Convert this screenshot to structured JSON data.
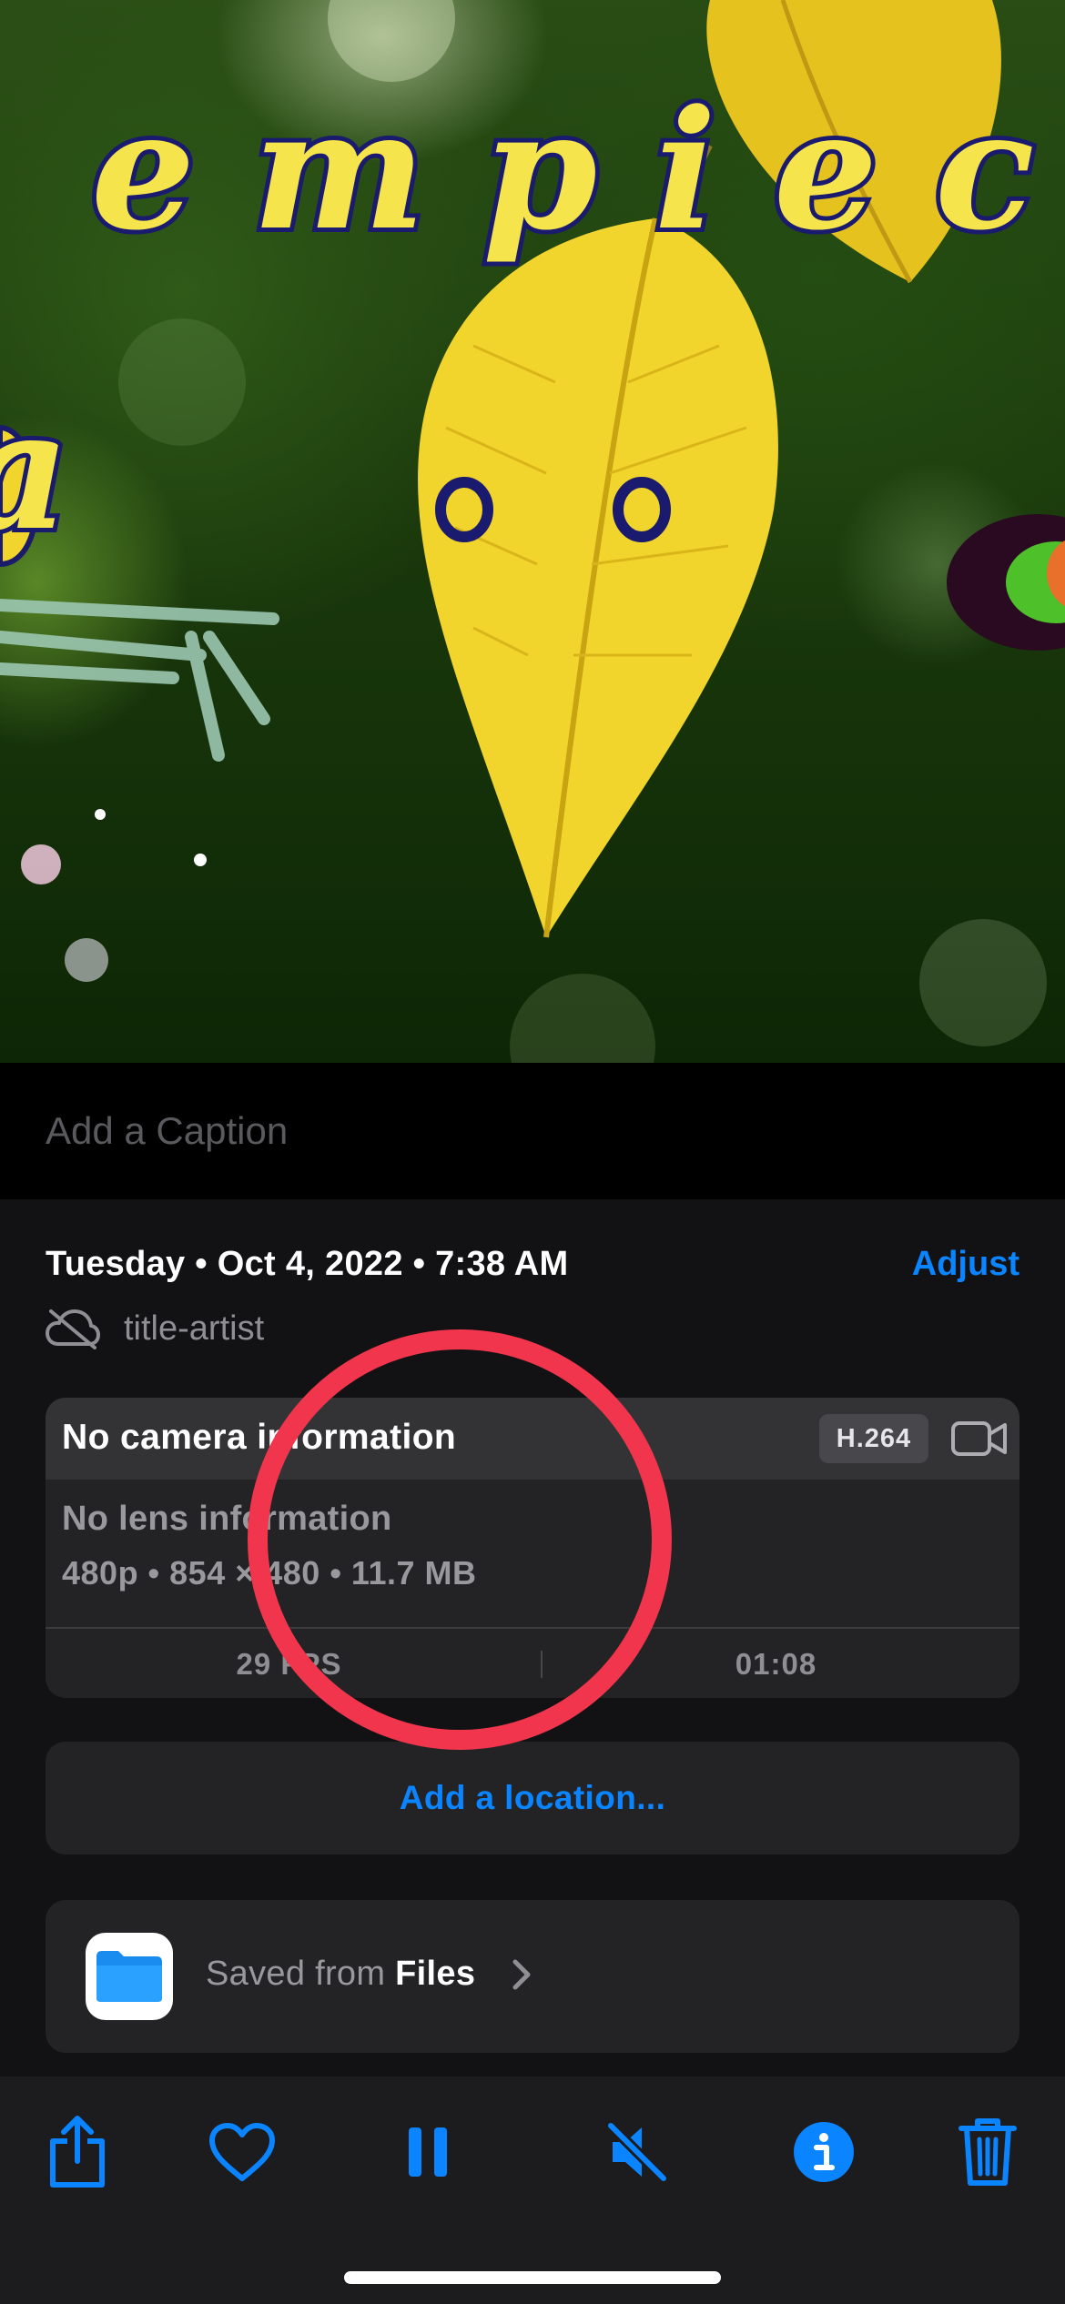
{
  "caption": {
    "placeholder": "Add a Caption"
  },
  "info": {
    "date_time": "Tuesday • Oct 4, 2022 • 7:38 AM",
    "adjust_label": "Adjust",
    "filename": "title-artist",
    "camera_info": "No camera information",
    "codec": "H.264",
    "lens_info": "No lens information",
    "specs": "480p  •  854 × 480  •  11.7 MB",
    "fps": "29 FPS",
    "duration": "01:08",
    "add_location": "Add a location...",
    "saved_prefix": "Saved from ",
    "saved_app": "Files"
  },
  "photo": {
    "overlay_text_top": "e m p i e c e",
    "overlay_text_left": "a"
  },
  "toolbar": {
    "icons": [
      "share-icon",
      "heart-icon",
      "pause-icon",
      "speaker-muted-icon",
      "info-icon",
      "trash-icon"
    ]
  },
  "colors": {
    "accent": "#0a84ff",
    "annotation": "#f0354d",
    "background": "#121214",
    "card": "#232325"
  }
}
